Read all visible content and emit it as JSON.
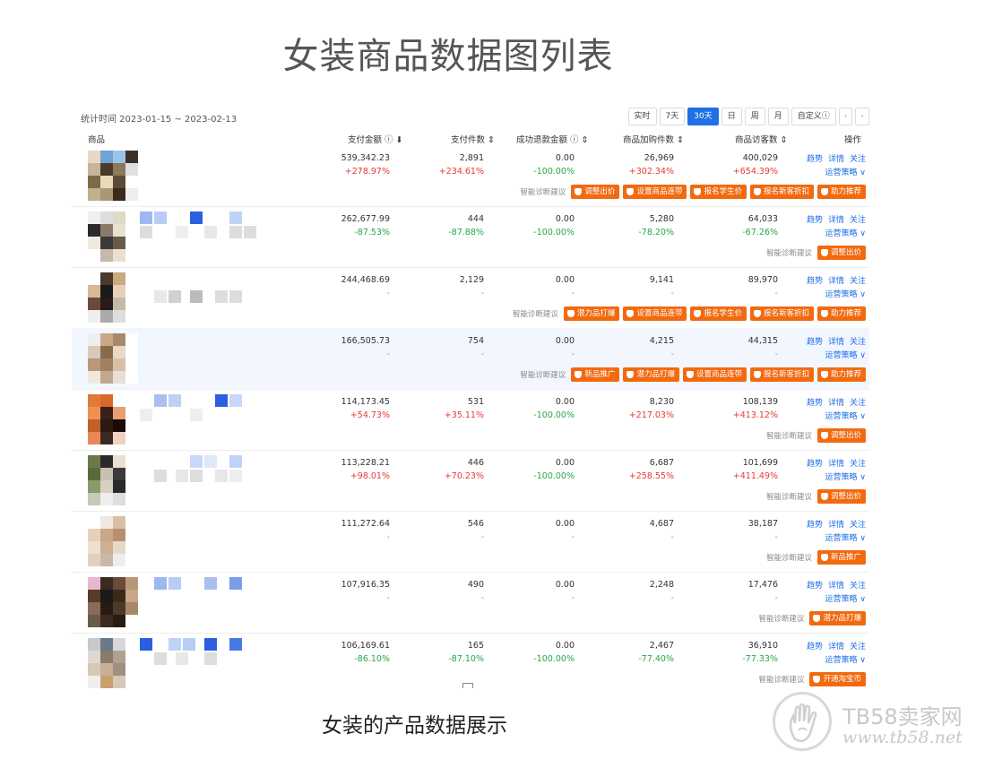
{
  "page_title": "女装商品数据图列表",
  "caption": "女装的产品数据展示",
  "watermark": {
    "name": "TB58卖家网",
    "url": "www.tb58.net"
  },
  "stat_time": "统计时间 2023-01-15 ~ 2023-02-13",
  "ranges": [
    "实时",
    "7天",
    "30天",
    "日",
    "周",
    "月",
    "自定义ⓘ"
  ],
  "active_range": "30天",
  "nav": {
    "prev": "‹",
    "next": "›"
  },
  "columns": {
    "product": "商品",
    "pay_amount": "支付金额 ⓘ ⬇",
    "pay_count": "支付件数 ⇕",
    "refund": "成功退款金额 ⓘ ⇕",
    "cart": "商品加购件数 ⇕",
    "visitors": "商品访客数 ⇕",
    "ops": "操作"
  },
  "ops_labels": {
    "trend": "趋势",
    "detail": "详情",
    "follow": "关注",
    "strategy": "运营策略 ∨"
  },
  "suggest_label": "智能诊断建议",
  "colors": {
    "accent": "#1f6fe5",
    "tag": "#f26a10",
    "up": "#e53935",
    "down": "#27a745"
  },
  "rows": [
    {
      "pay": "539,342.23",
      "pay_c": "+278.97%",
      "cnt": "2,891",
      "cnt_c": "+234.61%",
      "ref": "0.00",
      "ref_c": "-100.00%",
      "cart": "26,969",
      "cart_c": "+302.34%",
      "vis": "400,029",
      "vis_c": "+654.39%",
      "tags": [
        "调整出价",
        "设置商品连带",
        "报名学生价",
        "报名新客折扣",
        "助力推荐"
      ]
    },
    {
      "pay": "262,677.99",
      "pay_c": "-87.53%",
      "cnt": "444",
      "cnt_c": "-87.88%",
      "ref": "0.00",
      "ref_c": "-100.00%",
      "cart": "5,280",
      "cart_c": "-78.20%",
      "vis": "64,033",
      "vis_c": "-67.26%",
      "tags": [
        "调整出价"
      ]
    },
    {
      "pay": "244,468.69",
      "pay_c": "-",
      "cnt": "2,129",
      "cnt_c": "-",
      "ref": "0.00",
      "ref_c": "-",
      "cart": "9,141",
      "cart_c": "-",
      "vis": "89,970",
      "vis_c": "-",
      "tags": [
        "潜力品打爆",
        "设置商品连带",
        "报名学生价",
        "报名新客折扣",
        "助力推荐"
      ]
    },
    {
      "pay": "166,505.73",
      "pay_c": "-",
      "cnt": "754",
      "cnt_c": "-",
      "ref": "0.00",
      "ref_c": "-",
      "cart": "4,215",
      "cart_c": "-",
      "vis": "44,315",
      "vis_c": "-",
      "tags": [
        "新品推广",
        "潜力品打爆",
        "设置商品连带",
        "报名新客折扣",
        "助力推荐"
      ]
    },
    {
      "pay": "114,173.45",
      "pay_c": "+54.73%",
      "cnt": "531",
      "cnt_c": "+35.11%",
      "ref": "0.00",
      "ref_c": "-100.00%",
      "cart": "8,230",
      "cart_c": "+217.03%",
      "vis": "108,139",
      "vis_c": "+413.12%",
      "tags": [
        "调整出价"
      ]
    },
    {
      "pay": "113,228.21",
      "pay_c": "+98.01%",
      "cnt": "446",
      "cnt_c": "+70.23%",
      "ref": "0.00",
      "ref_c": "-100.00%",
      "cart": "6,687",
      "cart_c": "+258.55%",
      "vis": "101,699",
      "vis_c": "+411.49%",
      "tags": [
        "调整出价"
      ]
    },
    {
      "pay": "111,272.64",
      "pay_c": "-",
      "cnt": "546",
      "cnt_c": "-",
      "ref": "0.00",
      "ref_c": "-",
      "cart": "4,687",
      "cart_c": "-",
      "vis": "38,187",
      "vis_c": "-",
      "tags": [
        "新品推广"
      ]
    },
    {
      "pay": "107,916.35",
      "pay_c": "-",
      "cnt": "490",
      "cnt_c": "-",
      "ref": "0.00",
      "ref_c": "-",
      "cart": "2,248",
      "cart_c": "-",
      "vis": "17,476",
      "vis_c": "-",
      "tags": [
        "潜力品打爆"
      ]
    },
    {
      "pay": "106,169.61",
      "pay_c": "-86.10%",
      "cnt": "165",
      "cnt_c": "-87.10%",
      "ref": "0.00",
      "ref_c": "-100.00%",
      "cart": "2,467",
      "cart_c": "-77.40%",
      "vis": "36,910",
      "vis_c": "-77.33%",
      "tags": [
        "开通淘宝币"
      ]
    }
  ]
}
